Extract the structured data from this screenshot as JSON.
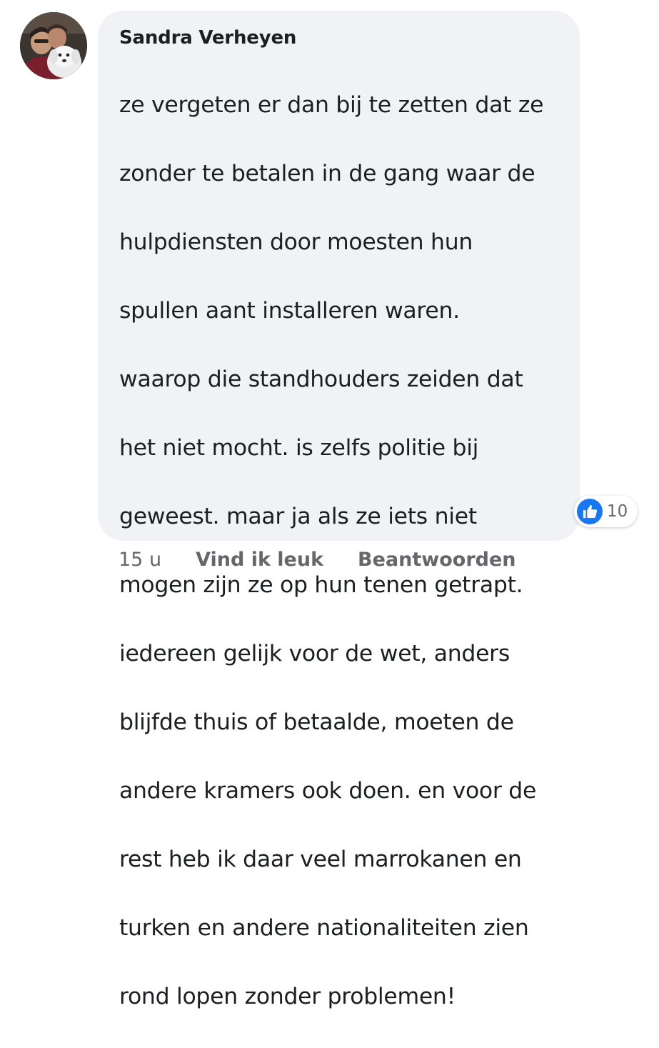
{
  "comment": {
    "author": "Sandra Verheyen",
    "lines": [
      "ze vergeten er dan bij te zetten dat ze",
      "zonder te betalen in de gang waar de",
      "hulpdiensten door moesten hun",
      "spullen aant installeren waren.",
      "waarop die standhouders zeiden dat",
      "het niet mocht. is zelfs politie bij",
      "geweest. maar ja als ze iets niet",
      "mogen zijn ze op hun tenen getrapt.",
      "iedereen gelijk voor de wet, anders",
      "blijfde thuis of betaalde, moeten de",
      "andere kramers ook doen. en voor de",
      "rest heb ik daar veel marrokanen en",
      "turken en andere nationaliteiten zien",
      "rond lopen zonder problemen!"
    ]
  },
  "reactions": {
    "icon": "like-icon",
    "count": "10",
    "accent": "#1877f2"
  },
  "actions": {
    "time": "15 u",
    "like_label": "Vind ik leuk",
    "reply_label": "Beantwoorden"
  },
  "colors": {
    "bubble": "#f0f2f5",
    "text": "#1c1e21",
    "muted": "#65676b"
  }
}
